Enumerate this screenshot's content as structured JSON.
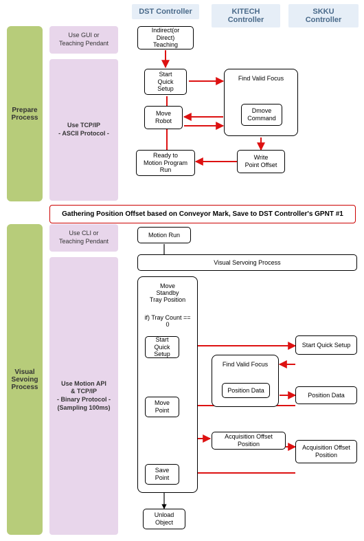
{
  "headers": {
    "dst": "DST Controller",
    "kitech": "KITECH Controller",
    "skku": "SKKU Controller"
  },
  "phases": {
    "prepare": "Prepare\nProcess",
    "vs": "Visual\nSevoing\nProcess"
  },
  "protocols": {
    "gui": "Use GUI or\nTeaching Pendant",
    "tcp": "Use TCP/IP\n- ASCII Protocol -",
    "cli": "Use CLI or\nTeaching Pendant",
    "api": "Use Motion API\n& TCP/IP\n- Binary Protocol -\n(Sampling 100ms)"
  },
  "prepare_nodes": {
    "teach": "Indirect(or Direct)\nTeaching",
    "start_qs": "Start\nQuick Setup",
    "move_robot": "Move\nRobot",
    "ready_mp": "Ready to\nMotion Program\nRun",
    "find_focus": "Find Valid Focus",
    "dmove": "Dmove\nCommand",
    "write_offset": "Write\nPoint Offset"
  },
  "banner": "Gathering Position Offset based on Conveyor Mark, Save to DST Controller's GPNT #1",
  "vs": {
    "motion_run": "Motion Run",
    "vs_process": "Visual Servoing Process",
    "dst_group": {
      "move_standby": "Move\nStandby\nTray Position",
      "cond": "if) Tray Count == 0",
      "start_qs": "Start\nQuick Setup",
      "move_point": "Move\nPoint",
      "save_point": "Save\nPoint"
    },
    "kitech": {
      "find_focus": "Find Valid Focus",
      "pos_data": "Position Data",
      "acq_offset": "Acquisition Offset Position"
    },
    "skku": {
      "start_qs": "Start Quick Setup",
      "pos_data": "Position Data",
      "acq_offset": "Acquisition Offset Position"
    },
    "unload": "Unload\nObject"
  }
}
